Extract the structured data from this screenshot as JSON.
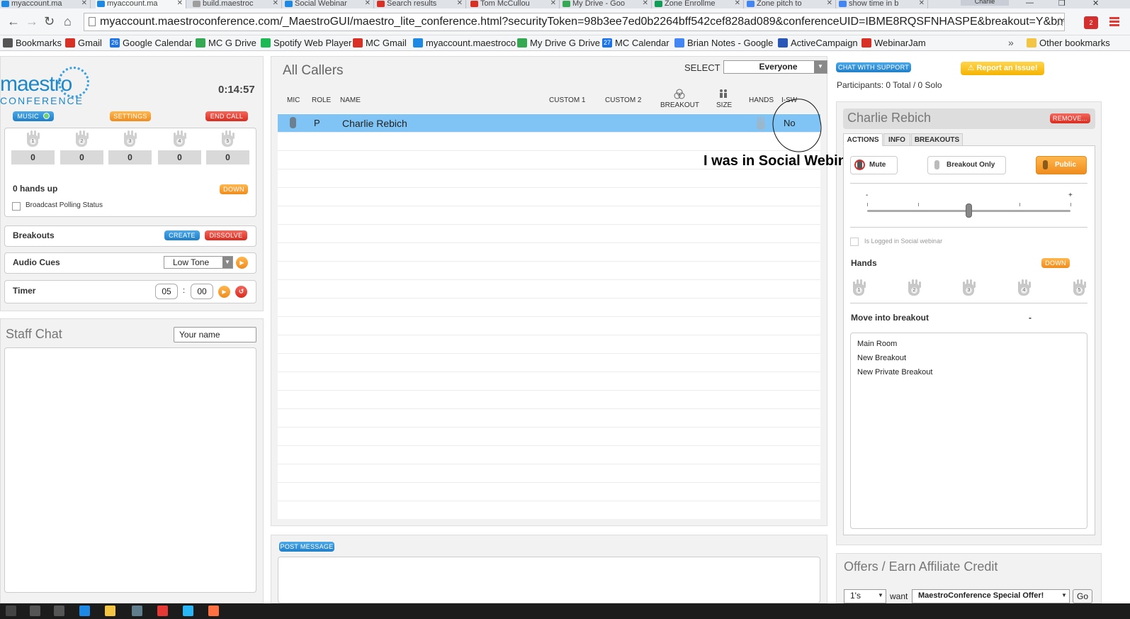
{
  "browser": {
    "tabs": [
      {
        "label": "myaccount.ma",
        "color": "#1e88e5"
      },
      {
        "label": "myaccount.ma",
        "color": "#1e88e5"
      },
      {
        "label": "build.maestroc",
        "color": "#9e9e9e"
      },
      {
        "label": "Social Webinar",
        "color": "#1e88e5"
      },
      {
        "label": "Search results",
        "color": "#d93025"
      },
      {
        "label": "Tom McCullou",
        "color": "#d93025"
      },
      {
        "label": "My Drive - Goo",
        "color": "#34a853"
      },
      {
        "label": "Zone Enrollme",
        "color": "#0f9d58"
      },
      {
        "label": "Zone pitch to",
        "color": "#4285f4"
      },
      {
        "label": "show time in b",
        "color": "#4285f4"
      }
    ],
    "profile": "Charlie",
    "url": "myaccount.maestroconference.com/_MaestroGUI/maestro_lite_conference.html?securityToken=98b3ee7ed0b2264bff542cef828ad089&conferenceUID=IBME8RQSFNHASPE&breakout=Y&bm=Y",
    "ext_badge": "2",
    "bookmarks": [
      {
        "label": "Bookmarks",
        "color": "#555555"
      },
      {
        "label": "Gmail",
        "color": "#d93025"
      },
      {
        "label": "Google Calendar",
        "color": "#1a73e8"
      },
      {
        "label": "MC G Drive",
        "color": "#34a853"
      },
      {
        "label": "Spotify Web Player",
        "color": "#1db954"
      },
      {
        "label": "MC Gmail",
        "color": "#d93025"
      },
      {
        "label": "myaccount.maestroco",
        "color": "#1e88e5"
      },
      {
        "label": "My Drive G Drive",
        "color": "#34a853"
      },
      {
        "label": "MC Calendar",
        "color": "#1a73e8"
      },
      {
        "label": "Brian Notes - Google",
        "color": "#4285f4"
      },
      {
        "label": "ActiveCampaign",
        "color": "#2957b8"
      },
      {
        "label": "WebinarJam",
        "color": "#d93025"
      }
    ],
    "calendar_day": "26",
    "calendar_day2": "27",
    "more": "»",
    "other_bookmarks": "Other bookmarks"
  },
  "left": {
    "logo_word": "maestro",
    "logo_sub": "CONFERENCE",
    "clock": "0:14:57",
    "music_label": "MUSIC",
    "settings_label": "SETTINGS",
    "end_call_label": "END CALL",
    "hand_counts": [
      "0",
      "0",
      "0",
      "0",
      "0"
    ],
    "hand_numbers": [
      "1",
      "2",
      "3",
      "4",
      "5"
    ],
    "hands_up": "0 hands up",
    "down_label": "DOWN",
    "broadcast_polling": "Broadcast Polling Status",
    "breakouts_label": "Breakouts",
    "create_label": "CREATE",
    "dissolve_label": "DISSOLVE",
    "audio_cues_label": "Audio Cues",
    "audio_cue_value": "Low Tone",
    "timer_label": "Timer",
    "timer_min": "05",
    "timer_sep": ":",
    "timer_sec": "00",
    "staff_chat_title": "Staff Chat",
    "your_name_placeholder": "Your name"
  },
  "center": {
    "tab_title": "All Callers",
    "select_label": "SELECT",
    "select_value": "Everyone",
    "columns": {
      "mic": "MIC",
      "role": "ROLE",
      "name": "NAME",
      "custom1": "CUSTOM 1",
      "custom2": "CUSTOM 2",
      "breakout": "BREAKOUT",
      "size": "SIZE",
      "hands": "HANDS",
      "sw": "I-SW"
    },
    "rows": [
      {
        "role": "P",
        "name": "Charlie Rebich",
        "sw": "No"
      }
    ],
    "annotation": "I was in Social Webinar",
    "post_message_label": "POST MESSAGE"
  },
  "right": {
    "chat_support_label": "CHAT WITH SUPPORT",
    "report_issue_label": "Report an Issue!",
    "participants": "Participants: 0 Total / 0 Solo",
    "caller_name": "Charlie Rebich",
    "remove_label": "REMOVE...",
    "tabs": [
      "ACTIONS",
      "INFO",
      "BREAKOUTS"
    ],
    "mute_label": "Mute",
    "breakout_only_label": "Breakout Only",
    "public_label": "Public",
    "slider_min": "-",
    "slider_max": "+",
    "volume_level": 0.5,
    "logged_in_label": "Is Logged in Social webinar",
    "hands_label": "Hands",
    "down_label": "DOWN",
    "hand_numbers": [
      "1",
      "2",
      "3",
      "4",
      "5"
    ],
    "move_breakout_label": "Move into breakout",
    "move_breakout_dash": "-",
    "breakout_options": [
      "Main Room",
      "New Breakout",
      "New Private Breakout"
    ],
    "offers_title": "Offers / Earn Affiliate Credit",
    "offer_qty": "1's",
    "want_label": "want",
    "offer_value": "MaestroConference Special Offer!",
    "go_label": "Go"
  }
}
